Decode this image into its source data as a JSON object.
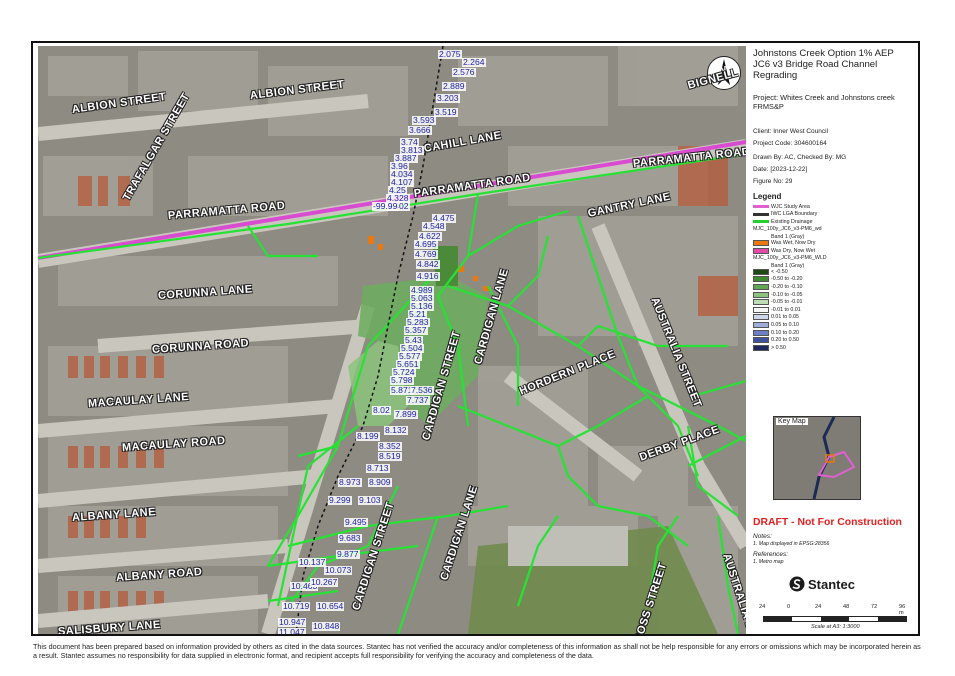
{
  "title": {
    "line1": "Johnstons Creek Option 1% AEP",
    "line2": "JC6 v3 Bridge Road Channel",
    "line3": "Regrading"
  },
  "project": "Project:  Whites  Creek  and  Johnstons creek FRMS&P",
  "client": "Client:  Inner West Council",
  "project_code": "Project Code:  304600164",
  "drawn_by": "Drawn By:  AC, Checked By: MG",
  "date": "Date:  [2023-12-22]",
  "figure_no": "Figure No:  29",
  "legend": {
    "heading": "Legend",
    "items": [
      {
        "label": "WJC Study Area",
        "color": "#e25fd1",
        "kind": "line"
      },
      {
        "label": "IWC LGA Boundary",
        "color": "#333333",
        "kind": "line"
      },
      {
        "label": "Existing Drainage",
        "color": "#22d12e",
        "kind": "line"
      },
      {
        "label": "MJC_100y_JC6_v3-PM6_wd",
        "color": "",
        "kind": "head"
      },
      {
        "label": "Band 1 (Gray)",
        "color": "",
        "kind": "sub"
      },
      {
        "label": "Was Wet, Now Dry",
        "color": "#e8780f",
        "kind": "box"
      },
      {
        "label": "Was Dry, Now Wet",
        "color": "#e24ca8",
        "kind": "box"
      },
      {
        "label": "MJC_100y_JC6_v3-PM6_WLD",
        "color": "",
        "kind": "head"
      },
      {
        "label": "Band 1 (Gray)",
        "color": "",
        "kind": "sub"
      },
      {
        "label": "< -0.50",
        "color": "#1f4a14",
        "kind": "box"
      },
      {
        "label": "-0.50 to -0.20",
        "color": "#3f8a2c",
        "kind": "box"
      },
      {
        "label": "-0.20 to -0.10",
        "color": "#62a852",
        "kind": "box"
      },
      {
        "label": "-0.10 to -0.05",
        "color": "#8cc47e",
        "kind": "box"
      },
      {
        "label": "-0.05 to -0.01",
        "color": "#bcdeb2",
        "kind": "box"
      },
      {
        "label": "-0.01 to 0.01",
        "color": "#f6f6f6",
        "kind": "box"
      },
      {
        "label": "0.01 to 0.05",
        "color": "#cfd6ec",
        "kind": "box"
      },
      {
        "label": "0.05 to 0.10",
        "color": "#9eaedb",
        "kind": "box"
      },
      {
        "label": "0.10 to 0.20",
        "color": "#6b7fc4",
        "kind": "box"
      },
      {
        "label": "0.20 to 0.50",
        "color": "#40529f",
        "kind": "box"
      },
      {
        "label": "> 0.50",
        "color": "#1f275e",
        "kind": "box"
      }
    ]
  },
  "key_map": "Key Map",
  "draft": "DRAFT - Not For Construction",
  "notes_heading": "Notes:",
  "notes": "1. Map displayed in EPSG:28356",
  "references_heading": "References:",
  "references": "1. Metro map",
  "logo_text": "Stantec",
  "scale": {
    "ticks": [
      "24",
      "0",
      "24",
      "48",
      "72",
      "96 m"
    ],
    "label": "Scale at A3: 1:3000"
  },
  "north": "N",
  "footer": "This document has been prepared based on information provided by others as cited in the data sources. Stantec has not verified the accuracy and/or completeness of this information as shall not be help responsible for any errors or omissions which may be incorporated herein as a result. Stantec assumes no responsibility for data supplied in electronic format, and recipient accepts full responsibility for verifying the accuracy and completeness of the data.",
  "streets": [
    "ALBION STREET",
    "ALBION STREET",
    "TRAFALGAR STREET",
    "CAHILL LANE",
    "PARRAMATTA ROAD",
    "PARRAMATTA ROAD",
    "PARRAMATTA ROAD",
    "BIGNELL",
    "GANTRY LANE",
    "AUSTRALIA STREET",
    "CORUNNA LANE",
    "CORUNNA ROAD",
    "MACAULAY LANE",
    "MACAULAY ROAD",
    "CARDIGAN STREET",
    "CARDIGAN LANE",
    "HORDERN PLACE",
    "DERBY PLACE",
    "ALBANY LANE",
    "ALBANY ROAD",
    "CARDIGAN STREET",
    "CARDIGAN LANE",
    "ROSS STREET",
    "AUSTRALIA LANE",
    "SALISBURY LANE"
  ],
  "levels": [
    "2.075",
    "2.264",
    "2.576",
    "2.889",
    "3.203",
    "3.519",
    "3.593",
    "3.666",
    "3.74",
    "3.813",
    "3.887",
    "3.96",
    "4.034",
    "4.107",
    "4.25",
    "4.328",
    "4.402",
    "-99.99",
    "4.475",
    "4.548",
    "4.622",
    "4.695",
    "4.769",
    "4.842",
    "4.916",
    "4.989",
    "5.063",
    "5.136",
    "5.21",
    "5.283",
    "5.357",
    "5.43",
    "5.504",
    "5.577",
    "5.651",
    "5.724",
    "5.798",
    "5.871",
    "7.536",
    "7.737",
    "8.02",
    "7.899",
    "8.132",
    "8.199",
    "8.352",
    "8.519",
    "8.713",
    "8.973",
    "8.909",
    "9.299",
    "9.103",
    "9.495",
    "9.683",
    "9.877",
    "10.137",
    "10.073",
    "10.463",
    "10.267",
    "10.719",
    "10.654",
    "10.947",
    "11.047",
    "10.848"
  ]
}
